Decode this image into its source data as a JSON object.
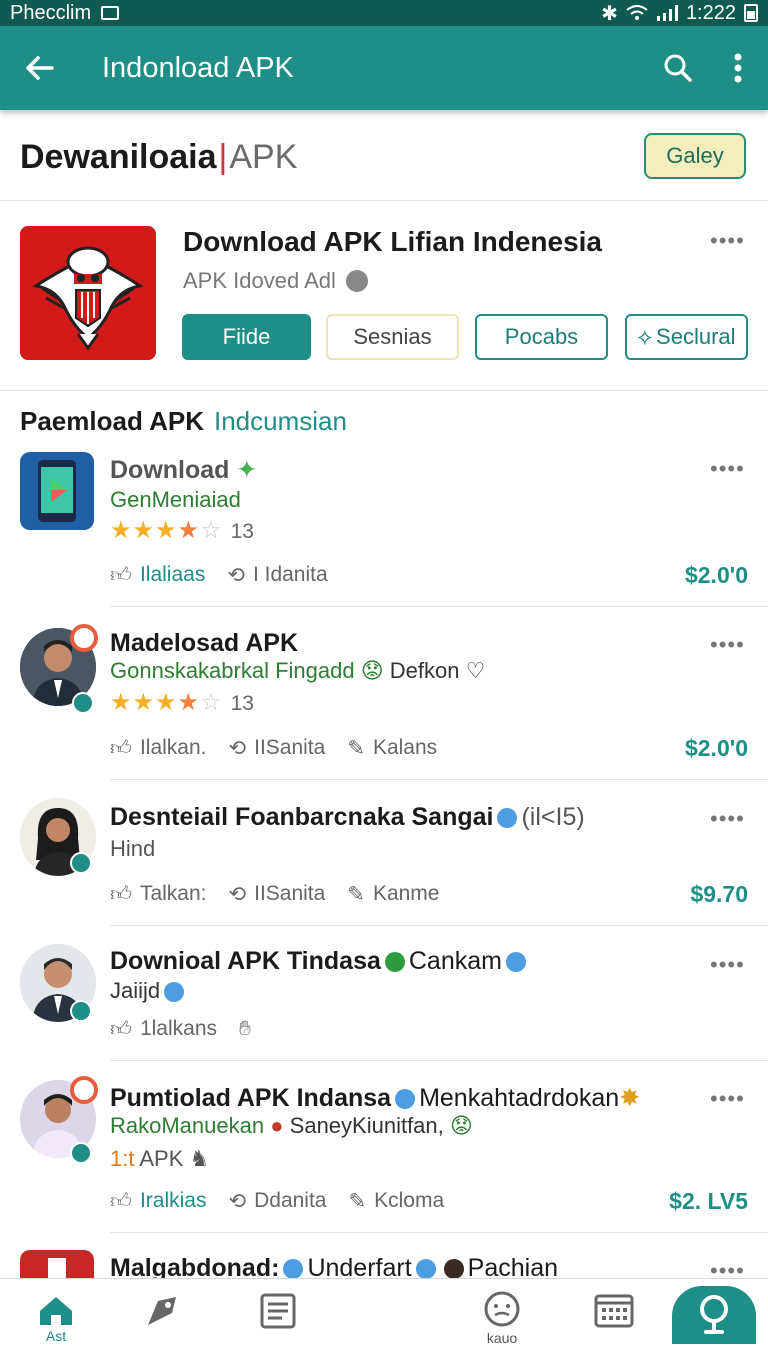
{
  "statusbar": {
    "carrier": "Phecclim",
    "time": "1:222"
  },
  "appbar": {
    "title": "Indonload APK"
  },
  "header": {
    "brand_bold": "Dewaniloaia",
    "brand_sep": "|",
    "brand_light": "APK",
    "gallery_button": "Galey"
  },
  "featured": {
    "title": "Download APK Lifian Indenesia",
    "subtitle": "APK Idoved Adl",
    "buttons": [
      "Fiide",
      "Sesnias",
      "Pocabs",
      "Seclural"
    ]
  },
  "section": {
    "title": "Paemload APK",
    "accent": "Indcumsian"
  },
  "list": [
    {
      "title": "Download",
      "sub": "GenMeniaiad",
      "rating_count": "13",
      "actions": [
        "Ilaliaas",
        "I Idanita"
      ],
      "price": "$2.0'0"
    },
    {
      "title": "Madelosad APK",
      "sub_green": "Gonnskakabrkal Fingadd",
      "sub_dark": "Defkon",
      "rating_count": "13",
      "actions": [
        "Ilalkan.",
        "IISanita",
        "Kalans"
      ],
      "price": "$2.0'0"
    },
    {
      "title": "Desnteiail Foanbarcnaka Sangai",
      "title_suffix": "(il<I5)",
      "sub": "Hind",
      "actions": [
        "Talkan:",
        "IISanita",
        "Kanme"
      ],
      "price": "$9.70"
    },
    {
      "title": "Downioal APK Tindasa",
      "title_suffix": "Cankam",
      "sub": "Jaiijd",
      "actions": [
        "1lalkans"
      ]
    },
    {
      "title": "Pumtiolad APK Indansa",
      "title_suffix": "Menkahtadrdokan",
      "sub_green": "RakoManuekan",
      "sub_dark": "SaneyKiunitfan,",
      "sub_line2_prefix": "1:t",
      "sub_line2": "APK",
      "actions": [
        "Iralkias",
        "Ddanita",
        "Kcloma"
      ],
      "price": "$2. LV5"
    },
    {
      "title": "Malgabdonad:",
      "title_suffix": "Underfart",
      "title_suffix2": "Pachian"
    }
  ],
  "bottomnav": {
    "home_label": "Ast",
    "face_label": "kauo"
  }
}
